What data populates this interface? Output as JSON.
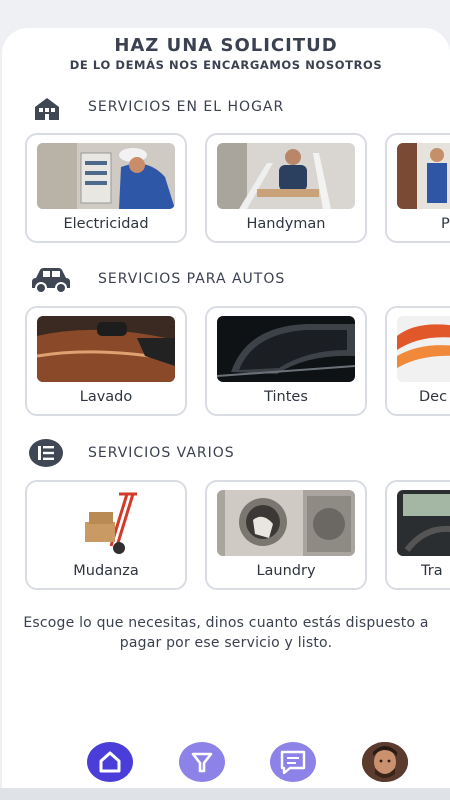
{
  "header": {
    "title": "HAZ UNA SOLICITUD",
    "subtitle": "DE LO DEMÁS NOS ENCARGAMOS NOSOTROS"
  },
  "sections": [
    {
      "icon": "house-icon",
      "label": "SERVICIOS EN EL HOGAR",
      "cards": [
        {
          "label": "Electricidad"
        },
        {
          "label": "Handyman"
        },
        {
          "label": "Pl"
        }
      ]
    },
    {
      "icon": "car-icon",
      "label": "SERVICIOS PARA AUTOS",
      "cards": [
        {
          "label": "Lavado"
        },
        {
          "label": "Tintes"
        },
        {
          "label": "Dec"
        }
      ]
    },
    {
      "icon": "list-icon",
      "label": "SERVICIOS VARIOS",
      "cards": [
        {
          "label": "Mudanza"
        },
        {
          "label": "Laundry"
        },
        {
          "label": "Tra"
        }
      ]
    }
  ],
  "description": "Escoge lo que necesitas, dinos cuanto estás dispuesto a pagar por ese servicio y listo.",
  "nav": {
    "items": [
      "home-icon",
      "filter-icon",
      "chat-icon",
      "avatar"
    ],
    "accent": "#4b3ed8",
    "accent_light": "#8d82e8"
  }
}
